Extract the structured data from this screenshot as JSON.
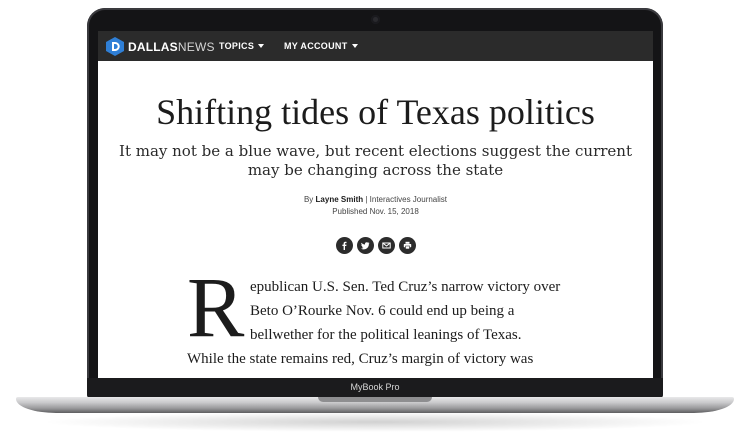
{
  "site": {
    "logo_bold": "DALLAS",
    "logo_light": "NEWS",
    "nav": [
      {
        "label": "TOPICS"
      },
      {
        "label": "MY ACCOUNT"
      }
    ]
  },
  "article": {
    "headline": "Shifting tides of Texas politics",
    "subhead": "It may not be a blue wave, but recent elections suggest the current may be changing across the state",
    "byline_prefix": "By",
    "author": "Layne Smith",
    "author_role": "| Interactives Journalist",
    "published": "Published Nov. 15, 2018",
    "share_icons": [
      "facebook-icon",
      "twitter-icon",
      "email-icon",
      "print-icon"
    ],
    "drop_cap": "R",
    "body_lines": [
      "epublican U.S. Sen. Ted Cruz’s narrow victory over",
      "Beto O’Rourke Nov. 6 could end up being a",
      "bellwether for the political leanings of Texas.",
      "While the state remains red, Cruz’s margin of victory was"
    ]
  },
  "device": {
    "label": "MyBook Pro"
  }
}
